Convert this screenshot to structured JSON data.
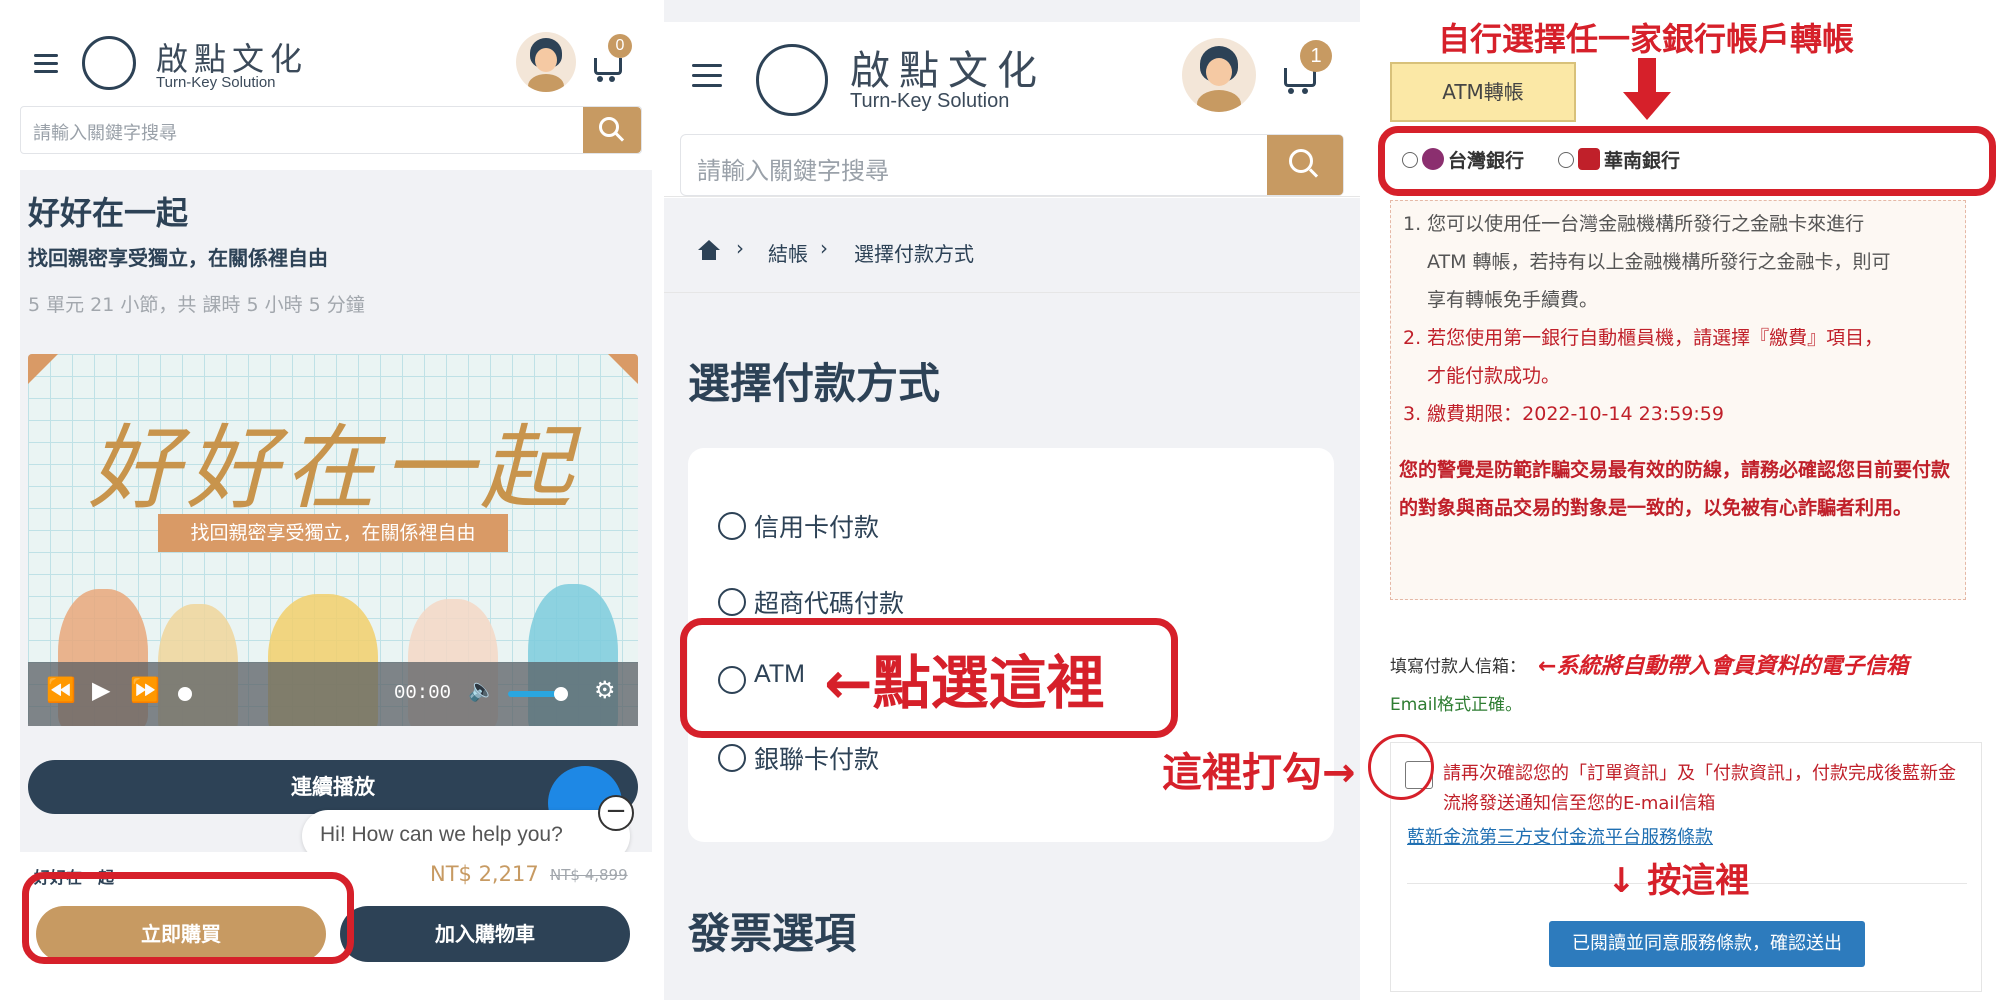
{
  "brand": {
    "name_zh": "啟點文化",
    "name_en": "Turn-Key Solution"
  },
  "panel1": {
    "cart_count": "0",
    "search_placeholder": "請輸入關鍵字搜尋",
    "course_title": "好好在一起",
    "course_subtitle": "找回親密享受獨立，在關係裡自由",
    "course_meta": "5 單元 21 小節，共 課時 5 小時 5 分鐘",
    "banner_title": "好好在一起",
    "banner_ribbon": "找回親密享受獨立，在關係裡自由",
    "player_time": "00:00",
    "play_all": "連續播放",
    "chat_text": "Hi! How can we help you?",
    "bottom_title": "好好在一起",
    "price": "NT$ 2,217",
    "old_price": "NT$ 4,899",
    "buy_now": "立即購買",
    "add_to_cart": "加入購物車"
  },
  "panel2": {
    "cart_count": "1",
    "search_placeholder": "請輸入關鍵字搜尋",
    "breadcrumb": [
      "結帳",
      "選擇付款方式"
    ],
    "heading": "選擇付款方式",
    "options": [
      "信用卡付款",
      "超商代碼付款",
      "ATM",
      "銀聯卡付款"
    ],
    "callout": "←點選這裡",
    "invoice_heading": "發票選項"
  },
  "panel3": {
    "top_instruction": "自行選擇任一家銀行帳戶轉帳",
    "atm_tab": "ATM轉帳",
    "banks": [
      "台灣銀行",
      "華南銀行"
    ],
    "notes": [
      "1. 您可以使用任一台灣金融機構所發行之金融卡來進行",
      "ATM 轉帳，若持有以上金融機構所發行之金融卡，則可",
      "享有轉帳免手續費。",
      "2. 若您使用第一銀行自動櫃員機，請選擇『繳費』項目，",
      "才能付款成功。",
      "3. 繳費期限：2022-10-14 23:59:59"
    ],
    "warning": "您的警覺是防範詐騙交易最有效的防線，請務必確認您目前要付款的對象與商品交易的對象是一致的，以免被有心詐騙者利用。",
    "email_label": "填寫付款人信箱：",
    "email_note": "←系統將自動帶入會員資料的電子信箱",
    "email_ok": "Email格式正確。",
    "check_callout": "這裡打勾→",
    "confirm_text": "請再次確認您的「訂單資訊」及「付款資訊」，付款完成後藍新金流將發送通知信至您的E-mail信箱",
    "terms_link": "藍新金流第三方支付金流平台服務條款",
    "press_here": "↓ 按這裡",
    "submit": "已閱讀並同意服務條款，確認送出"
  },
  "colors": {
    "navy": "#2d4256",
    "gold": "#c79a62",
    "red": "#d6202a",
    "link": "#1f6fb2",
    "submit": "#2d7bbd"
  },
  "icons": [
    "menu-icon",
    "logo-icon",
    "avatar",
    "cart-icon",
    "search-icon",
    "home-icon",
    "chevron-right-icon",
    "rewind-icon",
    "play-icon",
    "fast-forward-icon",
    "volume-icon",
    "gear-icon",
    "down-arrow-icon"
  ]
}
